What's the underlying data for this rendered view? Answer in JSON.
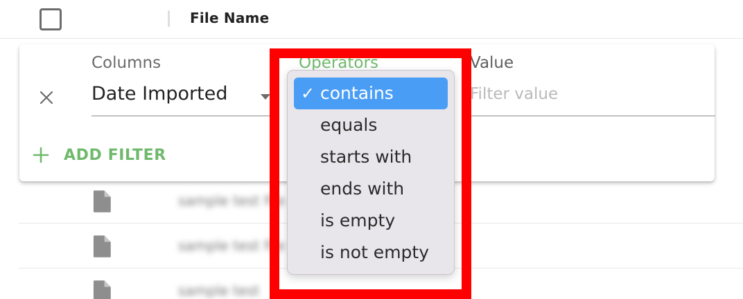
{
  "grid": {
    "header_title": "File Name",
    "rows": [
      {
        "name": "sample test file"
      },
      {
        "name": "sample test file"
      },
      {
        "name": "sample test"
      }
    ]
  },
  "filter": {
    "columns_label": "Columns",
    "columns_value": "Date Imported",
    "operators_label": "Operators",
    "value_label": "Value",
    "value_placeholder": "Filter value",
    "add_filter_label": "ADD FILTER"
  },
  "operators_menu": {
    "check_mark": "✓",
    "items": [
      {
        "label": "contains",
        "selected": true
      },
      {
        "label": "equals",
        "selected": false
      },
      {
        "label": "starts with",
        "selected": false
      },
      {
        "label": "ends with",
        "selected": false
      },
      {
        "label": "is empty",
        "selected": false
      },
      {
        "label": "is not empty",
        "selected": false
      }
    ]
  },
  "colors": {
    "accent_green": "#6fb96c",
    "selected_blue": "#4a9df5",
    "highlight_red": "#ff0000"
  },
  "icons": {
    "close": "close-icon",
    "add": "plus-icon",
    "caret": "caret-down-icon",
    "file": "file-icon",
    "check": "checkmark-icon"
  }
}
